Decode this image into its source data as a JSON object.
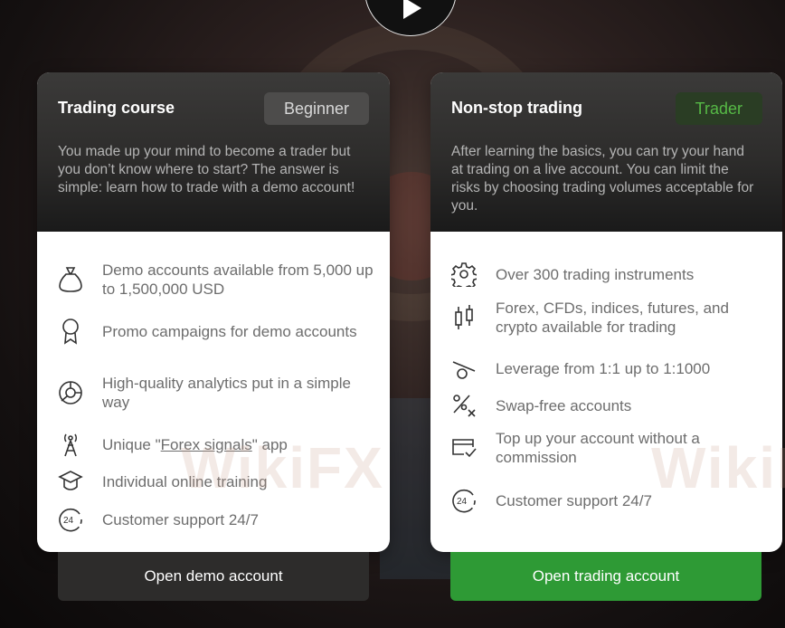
{
  "colors": {
    "accent_green": "#2e9a35",
    "trader_badge_text": "#56b946",
    "card_head": "#2d2c2b",
    "page_bg": "#141010"
  },
  "video": {
    "play_icon": "play-icon"
  },
  "cards": [
    {
      "title": "Trading course",
      "badge": "Beginner",
      "description": "You made up your mind to become a trader but you don’t know where to start? The answer is simple: learn how to trade with a demo account!",
      "features": [
        {
          "icon": "money-bag-icon",
          "text": "Demo accounts available from 5,000 up to 1,500,000 USD"
        },
        {
          "icon": "award-icon",
          "text": "Promo campaigns for demo accounts"
        },
        {
          "icon": "analytics-chart-icon",
          "text": "High-quality analytics put in a simple way"
        },
        {
          "icon": "signal-tower-icon",
          "text_before": "Unique \"",
          "link": "Forex signals",
          "text_after": "\" app"
        },
        {
          "icon": "graduation-cap-icon",
          "text": "Individual online training"
        },
        {
          "icon": "support-24-icon",
          "text": "Customer support 24/7"
        }
      ],
      "button": "Open demo account"
    },
    {
      "title": "Non-stop trading",
      "badge": "Trader",
      "description": "After learning the basics, you can try your hand at trading on a live account. You can limit the risks by choosing trading volumes acceptable for you.",
      "features": [
        {
          "icon": "gear-icon",
          "text": "Over 300 trading instruments"
        },
        {
          "icon": "candlestick-icon",
          "text": "Forex, CFDs, indices, futures, and crypto available for trading"
        },
        {
          "icon": "leverage-icon",
          "text": "Leverage from 1:1 up to 1:1000"
        },
        {
          "icon": "percent-swap-icon",
          "text": "Swap-free accounts"
        },
        {
          "icon": "card-check-icon",
          "text": "Top up your account without a commission"
        },
        {
          "icon": "support-24-icon",
          "text": "Customer support 24/7"
        }
      ],
      "button": "Open trading account"
    }
  ],
  "watermark": "WikiFX"
}
